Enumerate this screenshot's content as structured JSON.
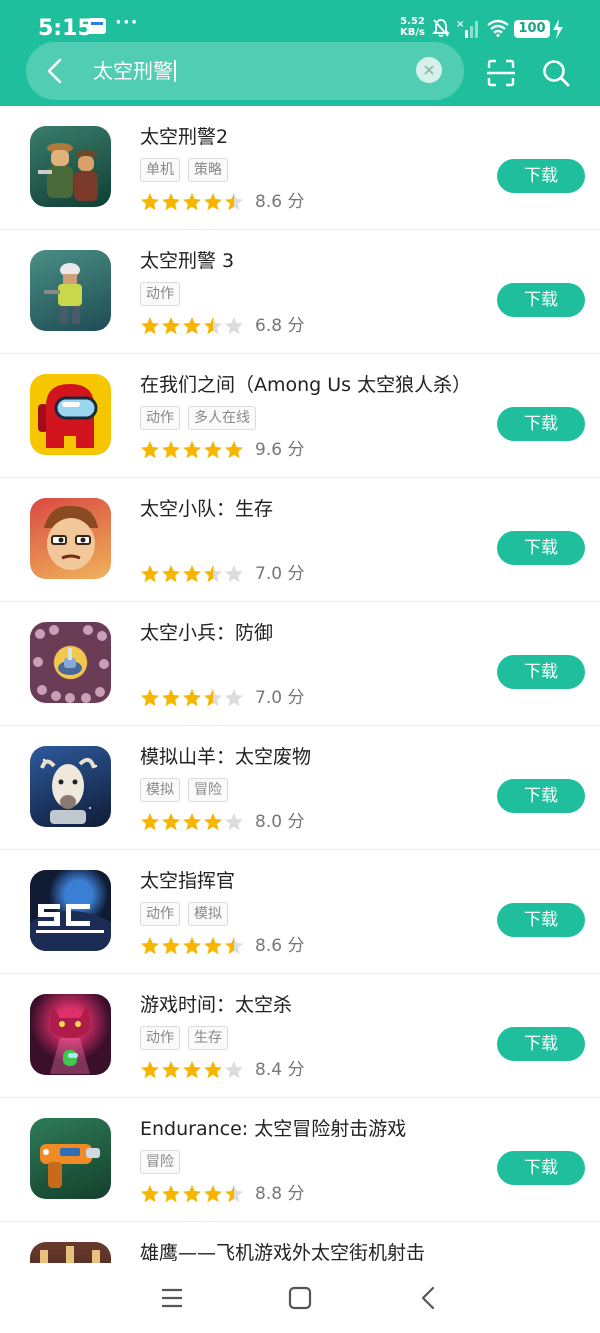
{
  "status_bar": {
    "time": "5:15",
    "dots": "···",
    "net_speed_value": "5.52",
    "net_speed_unit": "KB/s",
    "battery": "100"
  },
  "search": {
    "query": "太空刑警"
  },
  "colors": {
    "accent": "#1fbf9e",
    "star_filled": "#f7b500",
    "star_empty": "#dcdcdc"
  },
  "icons": {
    "back": "chevron-left-icon",
    "clear": "close-icon",
    "scan": "scan-icon",
    "search": "search-icon",
    "star": "star-icon"
  },
  "apps": [
    {
      "name": "太空刑警2",
      "tags": [
        "单机",
        "策略"
      ],
      "stars": 4.5,
      "score": "8.6 分",
      "action": "下载"
    },
    {
      "name": "太空刑警 3",
      "tags": [
        "动作"
      ],
      "stars": 3.5,
      "score": "6.8 分",
      "action": "下载"
    },
    {
      "name": "在我们之间（Among Us 太空狼人杀）",
      "tags": [
        "动作",
        "多人在线"
      ],
      "stars": 5,
      "score": "9.6 分",
      "action": "下载"
    },
    {
      "name": "太空小队：生存",
      "tags": [],
      "stars": 3.5,
      "score": "7.0 分",
      "action": "下载"
    },
    {
      "name": "太空小兵：防御",
      "tags": [],
      "stars": 3.5,
      "score": "7.0 分",
      "action": "下载"
    },
    {
      "name": "模拟山羊：太空废物",
      "tags": [
        "模拟",
        "冒险"
      ],
      "stars": 4,
      "score": "8.0 分",
      "action": "下载"
    },
    {
      "name": "太空指挥官",
      "tags": [
        "动作",
        "模拟"
      ],
      "stars": 4.5,
      "score": "8.6 分",
      "action": "下载"
    },
    {
      "name": "游戏时间：太空杀",
      "tags": [
        "动作",
        "生存"
      ],
      "stars": 4,
      "score": "8.4 分",
      "action": "下载"
    },
    {
      "name": "Endurance: 太空冒险射击游戏",
      "tags": [
        "冒险"
      ],
      "stars": 4.5,
      "score": "8.8 分",
      "action": "下载"
    },
    {
      "name": "雄鹰——飞机游戏外太空街机射击",
      "tags": [],
      "stars": 0,
      "score": "",
      "action": ""
    }
  ]
}
